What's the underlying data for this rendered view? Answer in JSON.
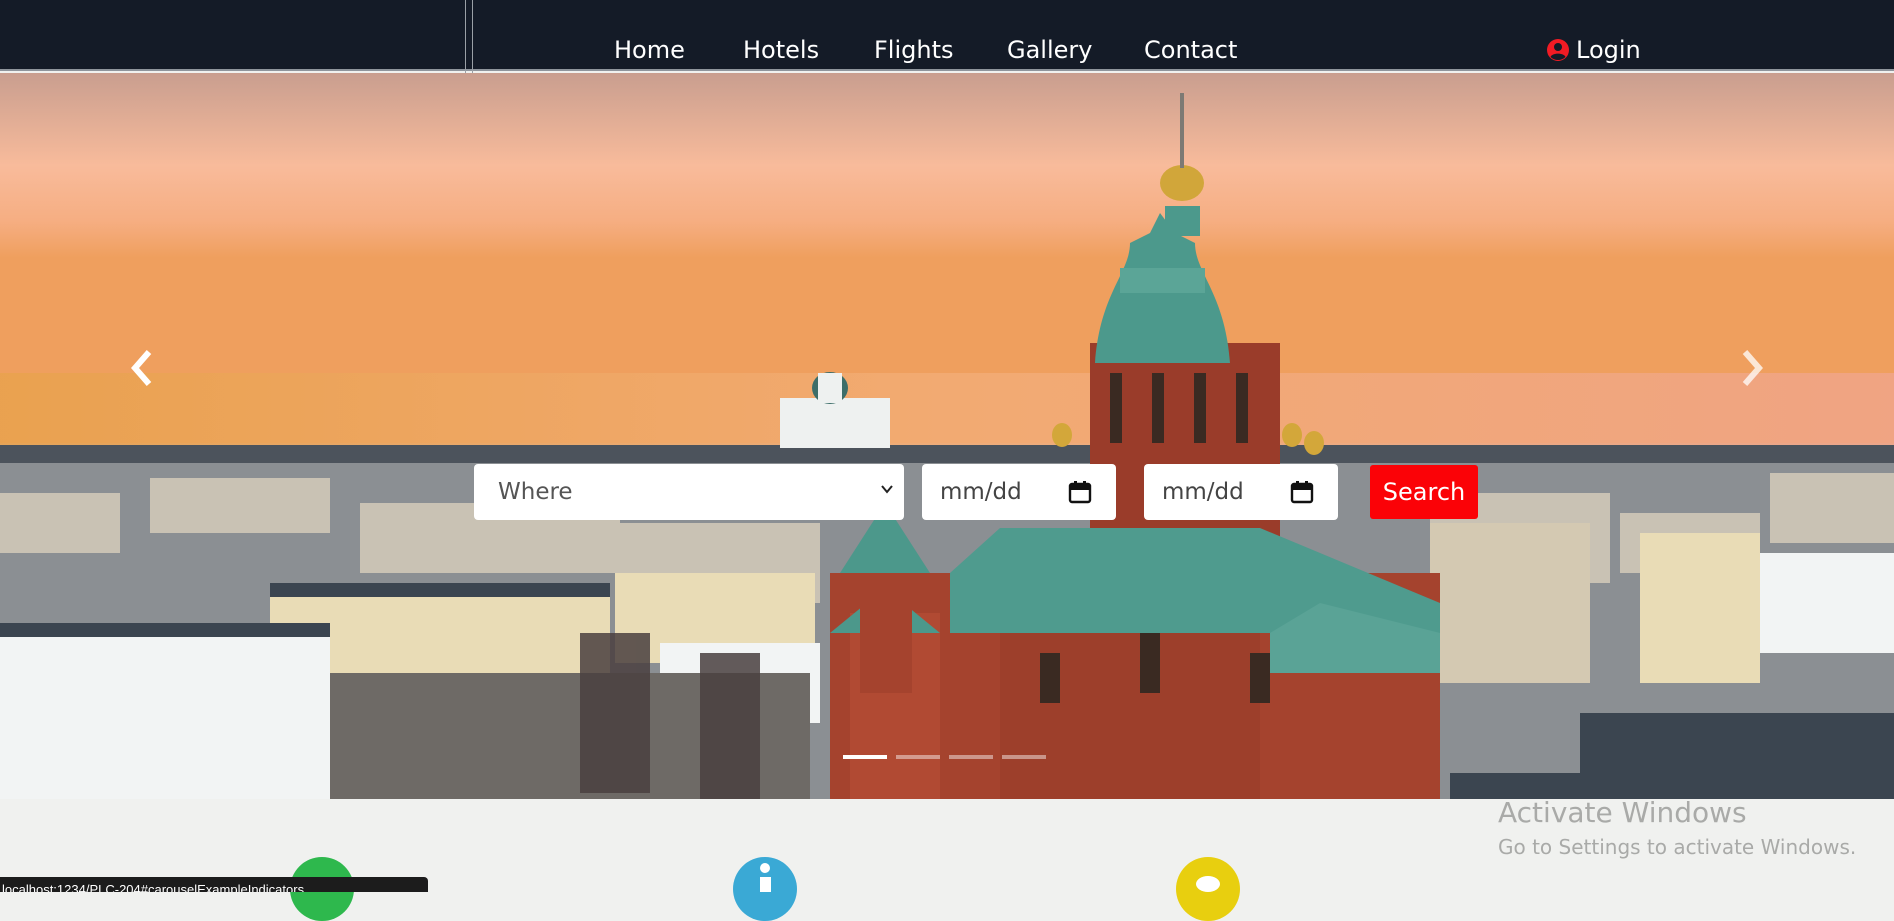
{
  "nav": {
    "links": [
      "Home",
      "Hotels",
      "Flights",
      "Gallery",
      "Contact"
    ],
    "login_label": "Login"
  },
  "hero": {
    "carousel_slides": 4,
    "active_slide": 1
  },
  "search": {
    "where_placeholder": "Where",
    "checkin_placeholder": "mm/dd",
    "checkout_placeholder": "mm/dd",
    "button_label": "Search"
  },
  "features": {
    "icons": [
      "phone-icon",
      "info-icon",
      "chat-icon"
    ],
    "colors": [
      "#2eb84d",
      "#3aa9d5",
      "#e8cf0f"
    ]
  },
  "watermark": {
    "line1": "Activate Windows",
    "line2": "Go to Settings to activate Windows."
  },
  "status_url": "localhost:1234/PLC-204#carouselExampleIndicators",
  "colors": {
    "nav_bg": "#141b27",
    "search_button": "#fb0207",
    "login_icon": "#f21b24"
  }
}
